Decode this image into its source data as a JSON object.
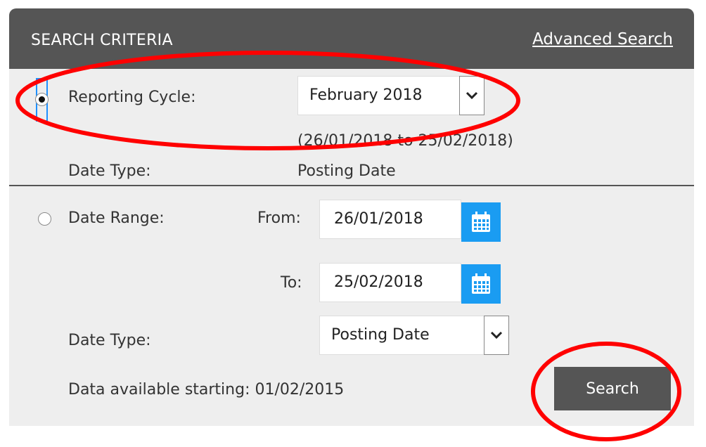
{
  "header": {
    "title": "SEARCH CRITERIA",
    "advanced_search_link": "Advanced Search"
  },
  "reporting_cycle": {
    "selected": true,
    "label": "Reporting Cycle:",
    "select_value": "February 2018",
    "range_text": "(26/01/2018 to 25/02/2018)",
    "date_type_label": "Date Type:",
    "date_type_value": "Posting Date"
  },
  "date_range": {
    "selected": false,
    "label": "Date Range:",
    "from_label": "From:",
    "from_value": "26/01/2018",
    "to_label": "To:",
    "to_value": "25/02/2018",
    "date_type_label": "Date Type:",
    "date_type_value": "Posting Date"
  },
  "footer": {
    "data_available_text": "Data available starting: 01/02/2015",
    "search_button": "Search"
  },
  "icons": {
    "calendar": "calendar-icon",
    "chevron": "chevron-down-icon"
  },
  "colors": {
    "header_bg": "#555555",
    "panel_bg": "#eeeeee",
    "accent_blue": "#1a9cf2",
    "annotation_red": "#ff0000"
  }
}
